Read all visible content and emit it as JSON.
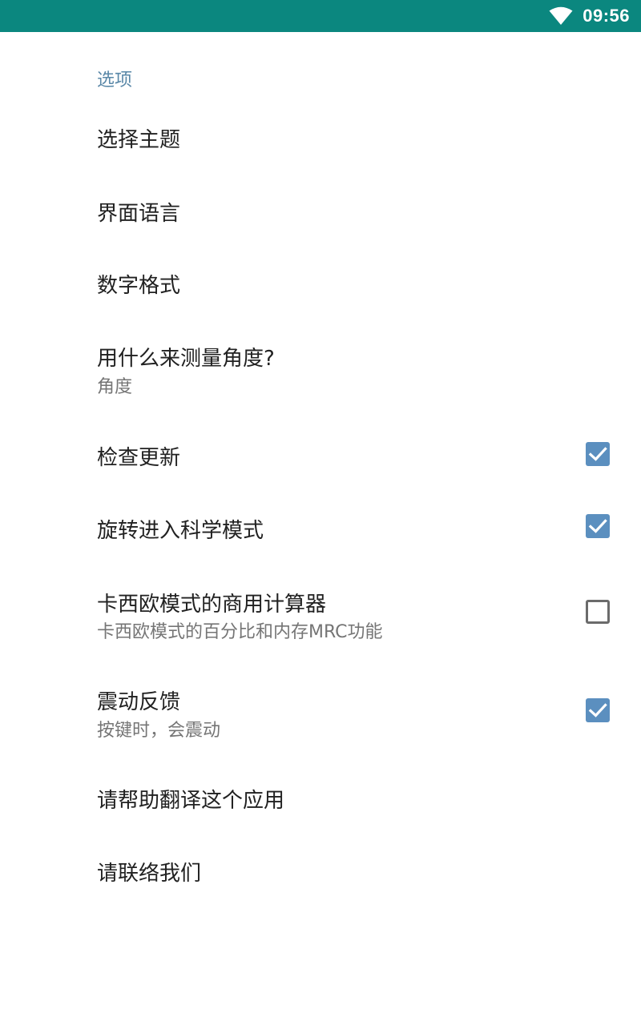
{
  "status_bar": {
    "time": "09:56",
    "wifi_icon": "wifi-icon"
  },
  "section": {
    "header": "选项"
  },
  "preferences": {
    "theme": {
      "title": "选择主题"
    },
    "language": {
      "title": "界面语言"
    },
    "number_format": {
      "title": "数字格式"
    },
    "angle": {
      "title": "用什么来测量角度?",
      "summary": "角度"
    },
    "check_updates": {
      "title": "检查更新",
      "checked": true
    },
    "rotate_scientific": {
      "title": "旋转进入科学模式",
      "checked": true
    },
    "casio_mode": {
      "title": "卡西欧模式的商用计算器",
      "summary": "卡西欧模式的百分比和内存MRC功能",
      "checked": false
    },
    "vibration": {
      "title": "震动反馈",
      "summary": "按键时，会震动",
      "checked": true
    },
    "translate": {
      "title": "请帮助翻译这个应用"
    },
    "contact": {
      "title": "请联络我们"
    }
  },
  "colors": {
    "status_bar": "#0b877f",
    "accent": "#5b8fbf",
    "section_header": "#5a88a8",
    "title_text": "#212121",
    "summary_text": "#757575"
  }
}
